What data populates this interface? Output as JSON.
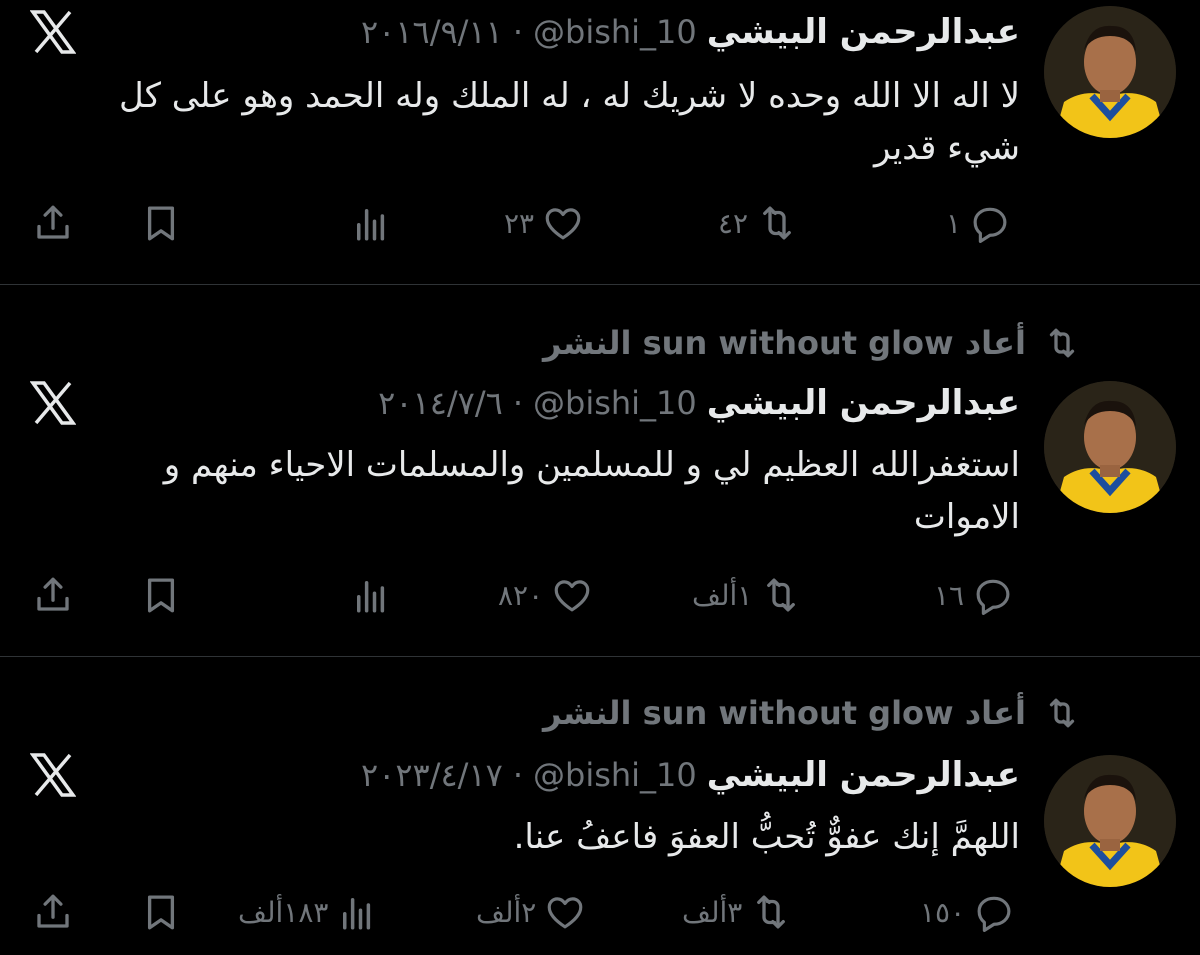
{
  "tweets": [
    {
      "retweeted_by": null,
      "retweet_label": "",
      "display_name": "عبدالرحمن البيشي",
      "handle": "@bishi_10",
      "separator": "·",
      "date": "٢٠١٦/٩/١١",
      "text": "لا اله الا الله وحده لا شريك له ، له الملك وله الحمد وهو على كل شيء قدير",
      "replies": "١",
      "retweets": "٤٢",
      "likes": "٢٣",
      "views": ""
    },
    {
      "retweeted_by": "sun without glow",
      "retweet_label": "أعاد sun without glow النشر",
      "display_name": "عبدالرحمن البيشي",
      "handle": "@bishi_10",
      "separator": "·",
      "date": "٢٠١٤/٧/٦",
      "text": "استغفرالله العظيم لي و للمسلمين والمسلمات الاحياء منهم و الاموات",
      "replies": "١٦",
      "retweets": "١ألف",
      "likes": "٨٢٠",
      "views": ""
    },
    {
      "retweeted_by": "sun without glow",
      "retweet_label": "أعاد sun without glow النشر",
      "display_name": "عبدالرحمن البيشي",
      "handle": "@bishi_10",
      "separator": "·",
      "date": "٢٠٢٣/٤/١٧",
      "text": "اللهمَّ إنك عفوٌّ تُحبُّ العفوَ فاعفُ عنا.",
      "replies": "١٥٠",
      "retweets": "٣ألف",
      "likes": "٢ألف",
      "views": "١٨٣ألف"
    }
  ],
  "icons": {
    "reply": "reply-icon",
    "retweet": "retweet-icon",
    "like": "heart-icon",
    "views": "analytics-icon",
    "bookmark": "bookmark-icon",
    "share": "share-icon",
    "source": "x-logo-icon"
  },
  "colors": {
    "background": "#000000",
    "text_primary": "#e7e9ea",
    "text_secondary": "#71767b",
    "divider": "#2f3336",
    "jersey_yellow": "#f2c418",
    "jersey_blue": "#1d4e9e"
  }
}
